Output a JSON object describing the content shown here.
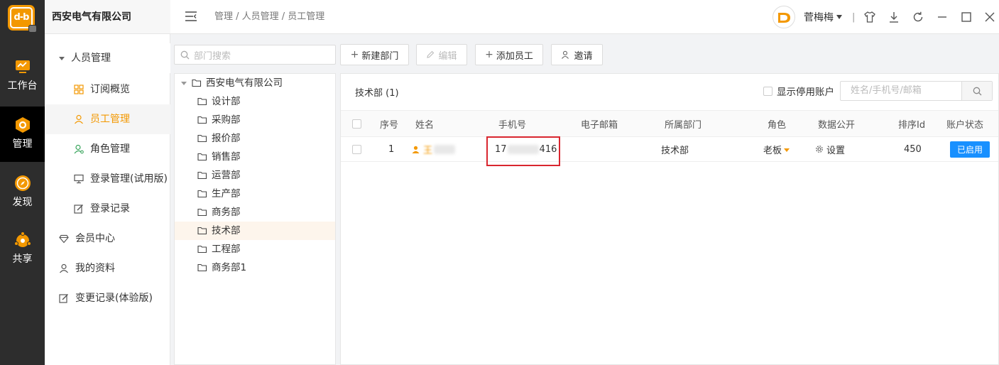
{
  "app": {
    "logo_text": "d-b",
    "company": "西安电气有限公司"
  },
  "rail": [
    {
      "label": "工作台",
      "icon": "monitor-icon"
    },
    {
      "label": "管理",
      "icon": "hexagon-icon"
    },
    {
      "label": "发现",
      "icon": "compass-icon"
    },
    {
      "label": "共享",
      "icon": "share-icon"
    }
  ],
  "sidebar": {
    "group_label": "人员管理",
    "items": [
      {
        "label": "订阅概览",
        "icon": "grid-icon"
      },
      {
        "label": "员工管理",
        "icon": "user-icon"
      },
      {
        "label": "角色管理",
        "icon": "user-role-icon"
      },
      {
        "label": "登录管理(试用版)",
        "icon": "monitor-small-icon"
      },
      {
        "label": "登录记录",
        "icon": "edit-icon"
      },
      {
        "label": "会员中心",
        "icon": "diamond-icon"
      },
      {
        "label": "我的资料",
        "icon": "person-icon"
      },
      {
        "label": "变更记录(体验版)",
        "icon": "edit-icon"
      }
    ]
  },
  "header": {
    "breadcrumb": "管理 / 人员管理 / 员工管理",
    "username": "菅梅梅",
    "separator": "|"
  },
  "toolbar": {
    "search_placeholder": "部门搜索",
    "new_dept": "新建部门",
    "edit": "编辑",
    "add_employee": "添加员工",
    "invite": "邀请"
  },
  "tree": {
    "root": "西安电气有限公司",
    "departments": [
      "设计部",
      "采购部",
      "报价部",
      "销售部",
      "运营部",
      "生产部",
      "商务部",
      "技术部",
      "工程部",
      "商务部1"
    ],
    "selected": "技术部"
  },
  "panel": {
    "dept_title": "技术部 (1)",
    "show_disabled": "显示停用账户",
    "search_placeholder": "姓名/手机号/邮箱",
    "columns": [
      "序号",
      "姓名",
      "手机号",
      "电子邮箱",
      "所属部门",
      "角色",
      "数据公开",
      "排序Id",
      "账户状态"
    ],
    "rows": [
      {
        "index": "1",
        "name": "王",
        "phone_prefix": "17",
        "phone_suffix": "416",
        "email": "",
        "dept": "技术部",
        "role": "老板",
        "data_public": "设置",
        "sort_id": "450",
        "status": "已启用"
      }
    ]
  },
  "colors": {
    "accent": "#f39800",
    "rail_bg": "#2d2d2d",
    "status_blue": "#1890ff",
    "highlight_red": "#d9262f"
  }
}
